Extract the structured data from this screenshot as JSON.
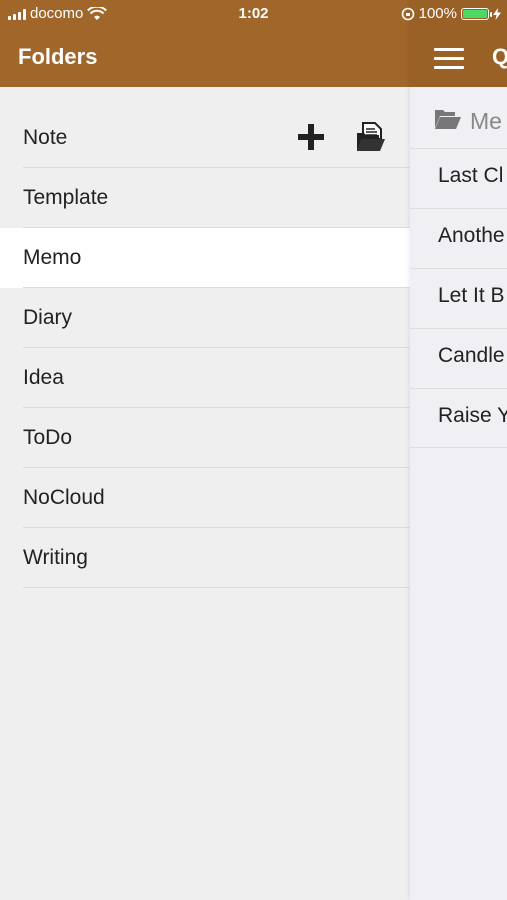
{
  "status_bar": {
    "carrier": "docomo",
    "time": "1:02",
    "battery_percent": "100%"
  },
  "folders_panel": {
    "title": "Folders",
    "folders": [
      {
        "label": "Note",
        "selected": false
      },
      {
        "label": "Template",
        "selected": false
      },
      {
        "label": "Memo",
        "selected": true
      },
      {
        "label": "Diary",
        "selected": false
      },
      {
        "label": "Idea",
        "selected": false
      },
      {
        "label": "ToDo",
        "selected": false
      },
      {
        "label": "NoCloud",
        "selected": false
      },
      {
        "label": "Writing",
        "selected": false
      }
    ],
    "actions": {
      "add_icon": "plus-icon",
      "folder_icon": "open-folder-document-icon"
    }
  },
  "notes_panel": {
    "header_text": "Q",
    "folder_label": "Me",
    "notes": [
      {
        "label": "Last Cl"
      },
      {
        "label": "Anothe"
      },
      {
        "label": "Let It B"
      },
      {
        "label": "Candle"
      },
      {
        "label": "Raise Y"
      }
    ]
  },
  "colors": {
    "header_brown": "#a0662a",
    "background": "#efefef",
    "selected_row": "#ffffff"
  }
}
